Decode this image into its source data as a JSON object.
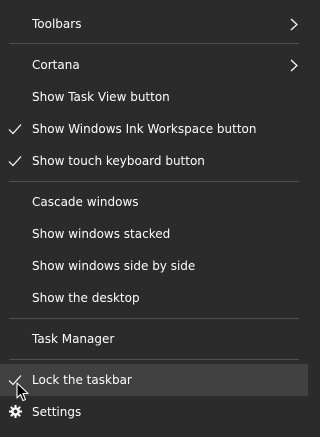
{
  "menu": {
    "toolbars": "Toolbars",
    "cortana": "Cortana",
    "show_task_view": "Show Task View button",
    "show_ink_workspace": "Show Windows Ink Workspace button",
    "show_touch_keyboard": "Show touch keyboard button",
    "cascade": "Cascade windows",
    "stacked": "Show windows stacked",
    "side_by_side": "Show windows side by side",
    "show_desktop": "Show the desktop",
    "task_manager": "Task Manager",
    "lock_taskbar": "Lock the taskbar",
    "settings": "Settings"
  },
  "icons": {
    "submenu": "chevron-right-icon",
    "checked": "checkmark-icon",
    "settings": "gear-icon",
    "pointer": "mouse-pointer-icon"
  },
  "colors": {
    "background": "#2b2b2b",
    "hover": "#414141",
    "separator": "#4f4f4f",
    "text": "#ffffff"
  }
}
